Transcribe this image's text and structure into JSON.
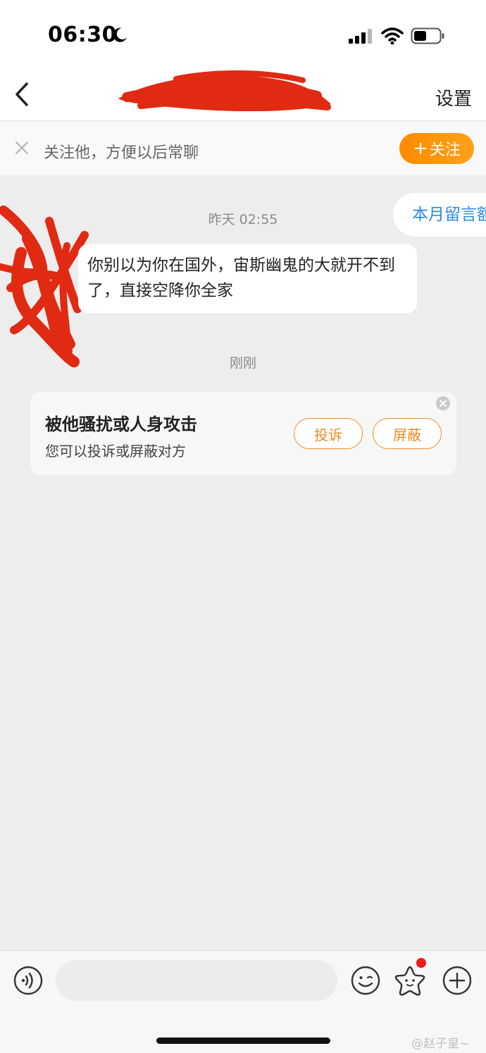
{
  "status_bar": {
    "time": "06:30",
    "icons": [
      "moon-icon",
      "signal-icon",
      "wifi-icon",
      "battery-icon"
    ]
  },
  "nav": {
    "back_icon": "chevron-left-icon",
    "settings_label": "设置"
  },
  "follow_banner": {
    "text": "关注他，方便以后常聊",
    "follow_button_plus": "+",
    "follow_button_label": "关注"
  },
  "chat": {
    "floating_tag": "本月留言额",
    "timestamp_1": "昨天 02:55",
    "message_text": "你别以为你在国外，宙斯幽鬼的大就开不到了，直接空降你全家",
    "timestamp_2": "刚刚",
    "report_card": {
      "title": "被他骚扰或人身攻击",
      "subtitle": "您可以投诉或屏蔽对方",
      "complain_label": "投诉",
      "block_label": "屏蔽"
    }
  },
  "input_bar": {
    "input_value": "",
    "input_placeholder": "",
    "icons": [
      "voice-icon",
      "emoji-icon",
      "star-icon",
      "plus-circle-icon"
    ]
  },
  "watermark": "@赵子皇~",
  "colors": {
    "accent_orange": "#f08a24",
    "link_blue": "#2a8be6",
    "badge_red": "#ee1c1c",
    "redaction_red": "#e02a12"
  }
}
